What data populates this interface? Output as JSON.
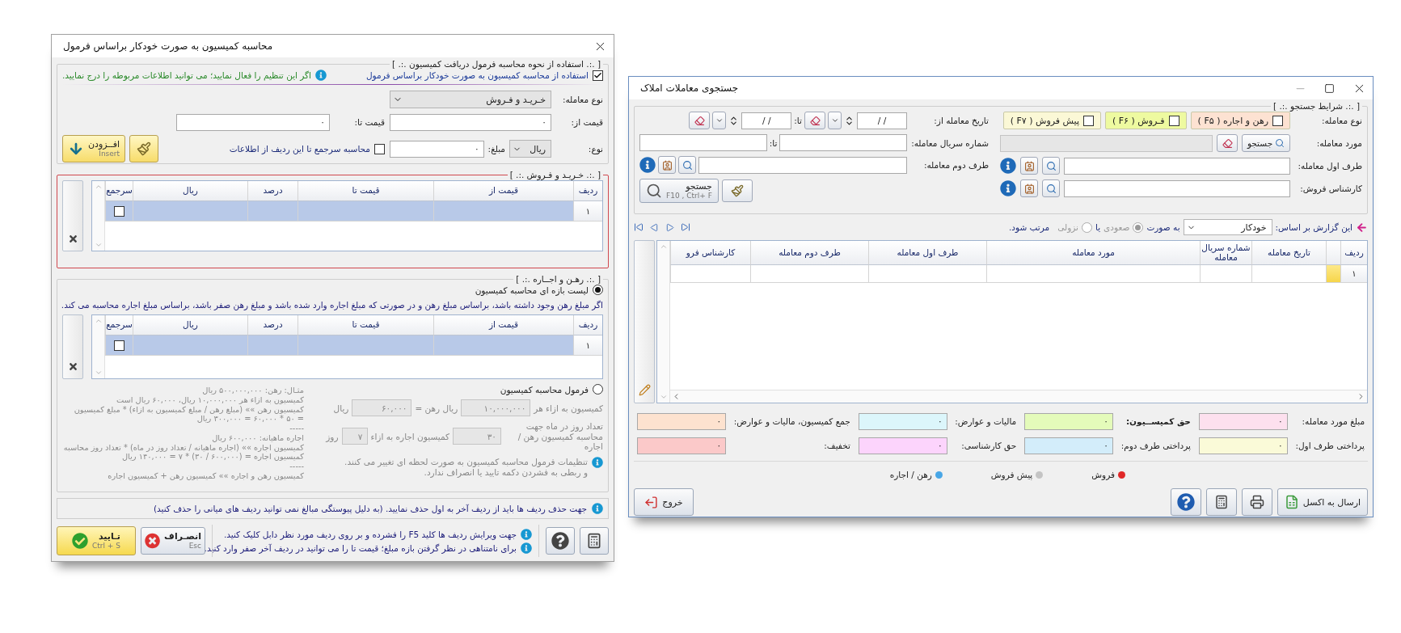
{
  "commission_window": {
    "title": "محاسبه کمیسیون به صورت خودکار براساس فرمول",
    "formula_group": {
      "legend": "[ .:. استفاده از نحوه محاسبه فرمول دریافت کمیسیون .:. ]",
      "auto": {
        "label": "استفاده از محاسبه کمیسیون به صورت خودکار براساس فرمول",
        "checked": true
      },
      "hint": "اگر این تنظیم را فعال نمایید؛ می توانید اطلاعات مربوطه را درج نمایید."
    },
    "entry": {
      "deal_type": {
        "label": "نوع معامله:",
        "value": "خـریـد و فـروش"
      },
      "price_from": {
        "label": "قیمت از:",
        "value": "۰"
      },
      "price_to": {
        "label": "قیمت تا:",
        "value": "۰"
      },
      "unit": {
        "label": "نوع:",
        "value": "ریال"
      },
      "amount": {
        "label": "مبلغ:",
        "value": "۰"
      },
      "cumulative": {
        "label": "محاسبه سرجمع تا این ردیف از اطلاعات",
        "checked": false
      },
      "insert_button": {
        "label": "افــزودن",
        "shortcut": "Insert"
      }
    },
    "sale_group": {
      "legend": "[ .:. خـریـد و فـروش .:. ]",
      "columns": [
        "ردیف",
        "قیمت از",
        "قیمت تا",
        "درصد",
        "ریال",
        "سرجمع"
      ],
      "rows": [
        {
          "row": "۱",
          "selected": true,
          "checked": false
        }
      ]
    },
    "rent_group": {
      "legend": "[ .:. رهـن و اجــاره .:. ]",
      "options": [
        {
          "label": "لیست بازه ای محاسبه کمیسیون",
          "selected": true
        },
        {
          "label": "فرمول محاسبه کمیسیون",
          "selected": false
        }
      ],
      "note": "اگر مبلغ رهن وجود داشته باشد، براساس مبلغ رهن و در صورتی که مبلغ اجاره وارد شده باشد و مبلغ رهن صفر باشد، براساس مبلغ اجاره محاسبه می کند.",
      "columns": [
        "ردیف",
        "قیمت از",
        "قیمت تا",
        "درصد",
        "ریال",
        "سرجمع"
      ],
      "rows": [
        {
          "row": "۱",
          "selected": true,
          "checked": false
        }
      ],
      "formula": {
        "per_label": "کمیسیون به ازاء هر",
        "per_value": "۱۰,۰۰۰,۰۰۰",
        "per_unit": "ریال رهن =",
        "fee_value": "۶۰,۰۰۰",
        "fee_unit": "ریال",
        "days_label": "تعداد روز در ماه جهت محاسبه کمیسیون رهن / اجاره",
        "days_value": "۳۰",
        "rent_label": "کمیسیون اجاره به ازاء",
        "rent_days": "۷",
        "rent_unit": "روز",
        "info": [
          "تنظیمات فرمول محاسبه کمیسیون به صورت لحظه ای تغییر می کنند.",
          "و ربطی به فشردن دکمه تایید یا انصراف ندارد."
        ],
        "example": [
          "مثـال: رهن: ۵۰۰,۰۰۰,۰۰۰ ریال",
          "کمیسیون به ازاء هر ۱۰,۰۰۰,۰۰۰ ریال، ۶۰,۰۰۰ ریال است",
          "کمیسیون رهن »» (مبلغ رهن / مبلغ کمیسیون به ازاء) * مبلغ کمیسیون",
          "= ۵۰ * ۶۰,۰۰۰ = ۳۰۰,۰۰۰ ریال",
          "-----",
          "اجاره ماهیانه: ۶۰۰,۰۰۰ ریال",
          "کمیسیون اجاره »» (اجاره ماهیانه / تعداد روز در ماه) * تعداد روز محاسبه",
          "کمیسیون اجاره = (۶۰۰,۰۰۰ / ۳۰) * ۷ = ۱۴۰,۰۰۰ ریال",
          "-----",
          "کمیسیون رهن و اجاره »» کمیسیون رهن + کمیسیون اجاره"
        ]
      }
    },
    "delete_note": "جهت حذف ردیف ها باید از ردیف آخر به اول حذف نمایید. (به دلیل پیوستگی مبالغ نمی توانید ردیف های میانی را حذف کنید)",
    "footer": {
      "notes": [
        "جهت ویرایش ردیف ها کلید F5 را فشرده و بر روی ردیف مورد نظر دابل کلیک کنید.",
        "برای نامتناهی در نظر گرفتن بازه مبلغ؛ قیمت تا را می توانید در ردیف آخر صفر وارد کنید."
      ],
      "cancel": {
        "label": "انصـراف",
        "shortcut": "Esc"
      },
      "confirm": {
        "label": "تـایید",
        "shortcut": "Ctrl + S"
      }
    }
  },
  "search_window": {
    "title": "جستجوی معاملات املاک",
    "criteria": {
      "legend": "[ .:. شرایط جستجو .:. ]",
      "deal_type_label": "نوع معامله:",
      "deal_types": [
        {
          "label": "رهن و اجاره ( F۵ )",
          "checked": false,
          "color": "#fde2d2"
        },
        {
          "label": "فـروش ( F۶ )",
          "checked": false,
          "color": "#eefaa0"
        },
        {
          "label": "پیش فروش ( F۷ )",
          "checked": false,
          "color": "#fbf8d6"
        }
      ],
      "date_from_label": "تاریخ معامله از:",
      "date_from": "/   /",
      "date_to_label": "تا:",
      "date_to": "/   /",
      "item_label": "مورد معامله:",
      "item_search": "جستجو",
      "serial_label": "شماره سریال معامله:",
      "serial_to_label": "تا:",
      "party1_label": "طرف اول معامله:",
      "party2_label": "طرف دوم معامله:",
      "expert_label": "کارشناس فروش:",
      "search_button": {
        "label": "جستجو",
        "shortcut": "F10 , Ctrl+ F"
      }
    },
    "sort": {
      "label": "این گزارش بر اساس:",
      "value": "خودکار",
      "as": "به صورت",
      "or": "یا",
      "tail": "مرتب شود.",
      "options": [
        {
          "label": "صعودی",
          "selected": true
        },
        {
          "label": "نزولی",
          "selected": false
        }
      ]
    },
    "grid": {
      "columns": [
        "ردیف",
        "تاریخ معامله",
        "شماره سریال معامله",
        "مورد معامله",
        "طرف اول معامله",
        "طرف دوم معامله",
        "کارشناس فرو"
      ],
      "rows": [
        {
          "row": "۱",
          "selected": true
        }
      ]
    },
    "totals": [
      {
        "label": "مبلغ مورد معامله:",
        "value": "۰",
        "color": "#fde0ee"
      },
      {
        "label": "حق کمیســیون:",
        "value": "۰",
        "color": "#e4fbba",
        "bold": true
      },
      {
        "label": "مالیات و عوارض:",
        "value": "۰",
        "color": "#dcf6fb"
      },
      {
        "label": "جمع کمیسیون، مالیات و عوارض:",
        "value": "۰",
        "color": "#fde2cf"
      },
      {
        "label": "پرداختی طرف اول:",
        "value": "۰",
        "color": "#fafad8"
      },
      {
        "label": "پرداختی طرف دوم:",
        "value": "۰",
        "color": "#d3edfa"
      },
      {
        "label": "حق کارشناسی:",
        "value": "۰",
        "color": "#fcd4fc"
      },
      {
        "label": "تخفیف:",
        "value": "۰",
        "color": "#fbc9c9"
      }
    ],
    "legend": [
      {
        "label": "فروش",
        "color": "#e02828"
      },
      {
        "label": "پیش فروش",
        "color": "#c4c4c4"
      },
      {
        "label": "رهن / اجاره",
        "color": "#48a6e6"
      }
    ],
    "buttons": {
      "excel": "ارسال به اکسل",
      "exit": "خروج"
    }
  }
}
